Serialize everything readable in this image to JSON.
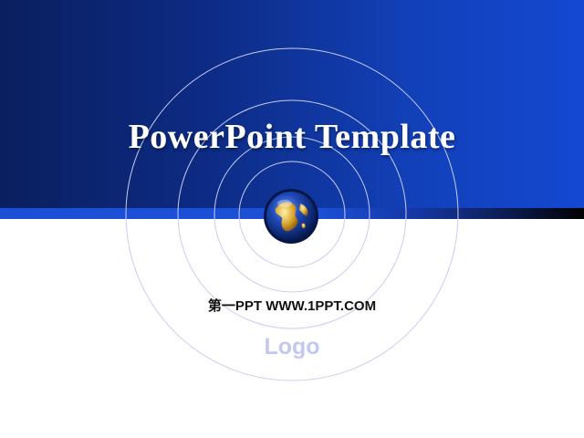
{
  "slide": {
    "title": "PowerPoint Template",
    "subtitle": "第一PPT WWW.1PPT.COM",
    "logo_text": "Logo",
    "icons": {
      "globe": "globe-icon"
    },
    "colors": {
      "header_dark": "#0a1f5e",
      "header_light": "#1448d2",
      "accent_bar": "#1a4fd6",
      "ring": "#c8cdf0",
      "logo_text": "#c3c8ee",
      "background": "#ffffff"
    }
  }
}
